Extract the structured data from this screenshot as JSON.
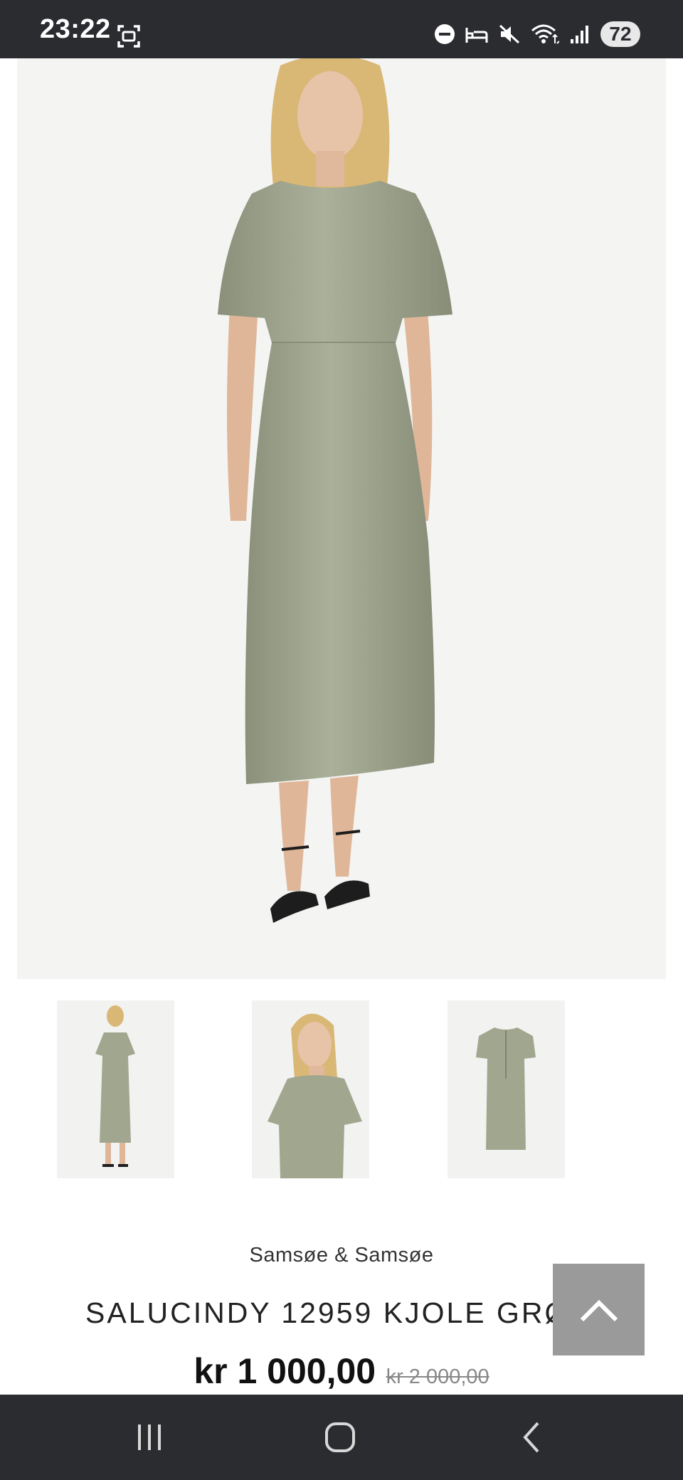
{
  "status_bar": {
    "time": "23:22",
    "battery_level": "72",
    "icons": [
      "screenshot-icon",
      "do-not-disturb-icon",
      "sleep-mode-icon",
      "mute-icon",
      "wifi-icon",
      "signal-icon",
      "battery-icon"
    ]
  },
  "product": {
    "brand": "Samsøe & Samsøe",
    "title": "SALUCINDY 12959 KJOLE GRØNN",
    "price_current": "kr 1 000,00",
    "price_old": "kr 2 000,00",
    "dress_color": "#9fa58e",
    "background_color": "#f4f4f3"
  },
  "gallery": {
    "thumbnails": [
      "thumbnail-front",
      "thumbnail-side",
      "thumbnail-back"
    ]
  },
  "controls": {
    "scroll_top_icon": "chevron-up-icon"
  },
  "navigation": {
    "recents_icon": "recents-icon",
    "home_icon": "home-icon",
    "back_icon": "back-icon"
  }
}
